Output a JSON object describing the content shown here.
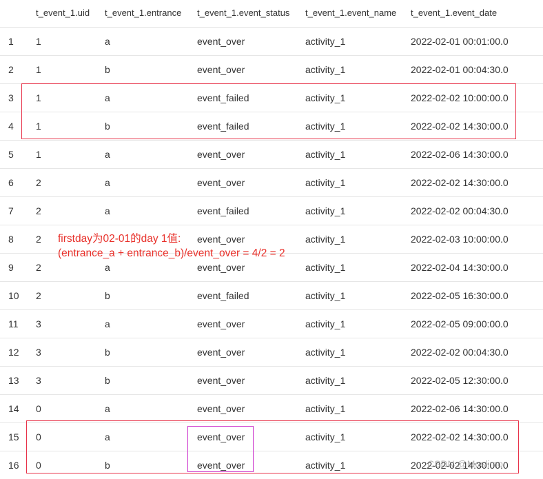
{
  "columns": [
    "",
    "t_event_1.uid",
    "t_event_1.entrance",
    "t_event_1.event_status",
    "t_event_1.event_name",
    "t_event_1.event_date"
  ],
  "rows": [
    [
      "1",
      "1",
      "a",
      "event_over",
      "activity_1",
      "2022-02-01 00:01:00.0"
    ],
    [
      "2",
      "1",
      "b",
      "event_over",
      "activity_1",
      "2022-02-01 00:04:30.0"
    ],
    [
      "3",
      "1",
      "a",
      "event_failed",
      "activity_1",
      "2022-02-02 10:00:00.0"
    ],
    [
      "4",
      "1",
      "b",
      "event_failed",
      "activity_1",
      "2022-02-02 14:30:00.0"
    ],
    [
      "5",
      "1",
      "a",
      "event_over",
      "activity_1",
      "2022-02-06 14:30:00.0"
    ],
    [
      "6",
      "2",
      "a",
      "event_over",
      "activity_1",
      "2022-02-02 14:30:00.0"
    ],
    [
      "7",
      "2",
      "a",
      "event_failed",
      "activity_1",
      "2022-02-02 00:04:30.0"
    ],
    [
      "8",
      "2",
      "",
      "event_over",
      "activity_1",
      "2022-02-03 10:00:00.0"
    ],
    [
      "9",
      "2",
      "a",
      "event_over",
      "activity_1",
      "2022-02-04 14:30:00.0"
    ],
    [
      "10",
      "2",
      "b",
      "event_failed",
      "activity_1",
      "2022-02-05 16:30:00.0"
    ],
    [
      "11",
      "3",
      "a",
      "event_over",
      "activity_1",
      "2022-02-05 09:00:00.0"
    ],
    [
      "12",
      "3",
      "b",
      "event_over",
      "activity_1",
      "2022-02-02 00:04:30.0"
    ],
    [
      "13",
      "3",
      "b",
      "event_over",
      "activity_1",
      "2022-02-05 12:30:00.0"
    ],
    [
      "14",
      "0",
      "a",
      "event_over",
      "activity_1",
      "2022-02-06 14:30:00.0"
    ],
    [
      "15",
      "0",
      "a",
      "event_over",
      "activity_1",
      "2022-02-02 14:30:00.0"
    ],
    [
      "16",
      "0",
      "b",
      "event_over",
      "activity_1",
      "2022-02-02 14:30:00.0"
    ]
  ],
  "annotation": {
    "line1": "firstday为02-01的day 1值:",
    "line2": "(entrance_a + entrance_b)/event_over = 4/2 = 2"
  },
  "watermark": "CSDN @Moslimo",
  "colors": {
    "highlight_red": "#e8334a",
    "highlight_magenta": "#cc33cc",
    "annotation_text": "#e8302a"
  }
}
